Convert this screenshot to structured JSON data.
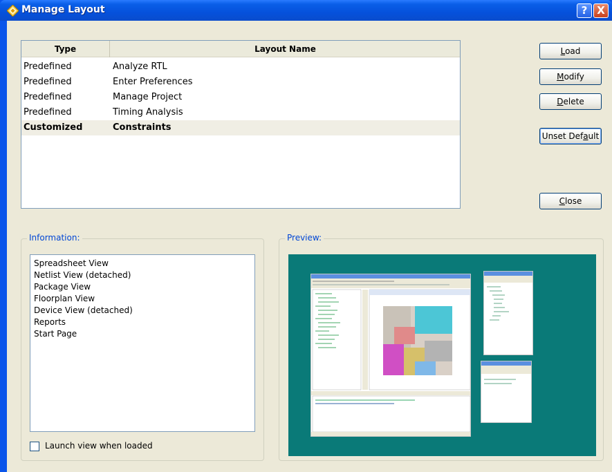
{
  "window": {
    "title": "Manage Layout",
    "help_label": "?",
    "close_label": "X"
  },
  "layouts_table": {
    "columns": [
      "Type",
      "Layout Name"
    ],
    "rows": [
      {
        "type": "Predefined",
        "name": "Analyze RTL",
        "selected": false
      },
      {
        "type": "Predefined",
        "name": "Enter Preferences",
        "selected": false
      },
      {
        "type": "Predefined",
        "name": "Manage Project",
        "selected": false
      },
      {
        "type": "Predefined",
        "name": "Timing Analysis",
        "selected": false
      },
      {
        "type": "Customized",
        "name": "Constraints",
        "selected": true
      }
    ]
  },
  "buttons": {
    "load": {
      "accel": "L",
      "rest": "oad"
    },
    "modify": {
      "accel": "M",
      "rest": "odify"
    },
    "delete": {
      "accel": "D",
      "rest": "elete"
    },
    "unset_default": {
      "pre": "Unset Def",
      "accel": "a",
      "rest": "ult"
    },
    "close": {
      "accel": "C",
      "rest": "lose"
    }
  },
  "information": {
    "legend": "Information:",
    "views": [
      "Spreadsheet View",
      "Netlist View (detached)",
      "Package View",
      "Floorplan View",
      "Device View (detached)",
      "Reports",
      "Start Page"
    ],
    "launch_checkbox": {
      "label": "Launch view when loaded",
      "checked": false
    }
  },
  "preview": {
    "legend": "Preview:",
    "background_color": "#0a7a78"
  },
  "colors": {
    "title_blue": "#0a55ea",
    "dialog_bg": "#ece9d8",
    "group_label": "#0046d5"
  }
}
